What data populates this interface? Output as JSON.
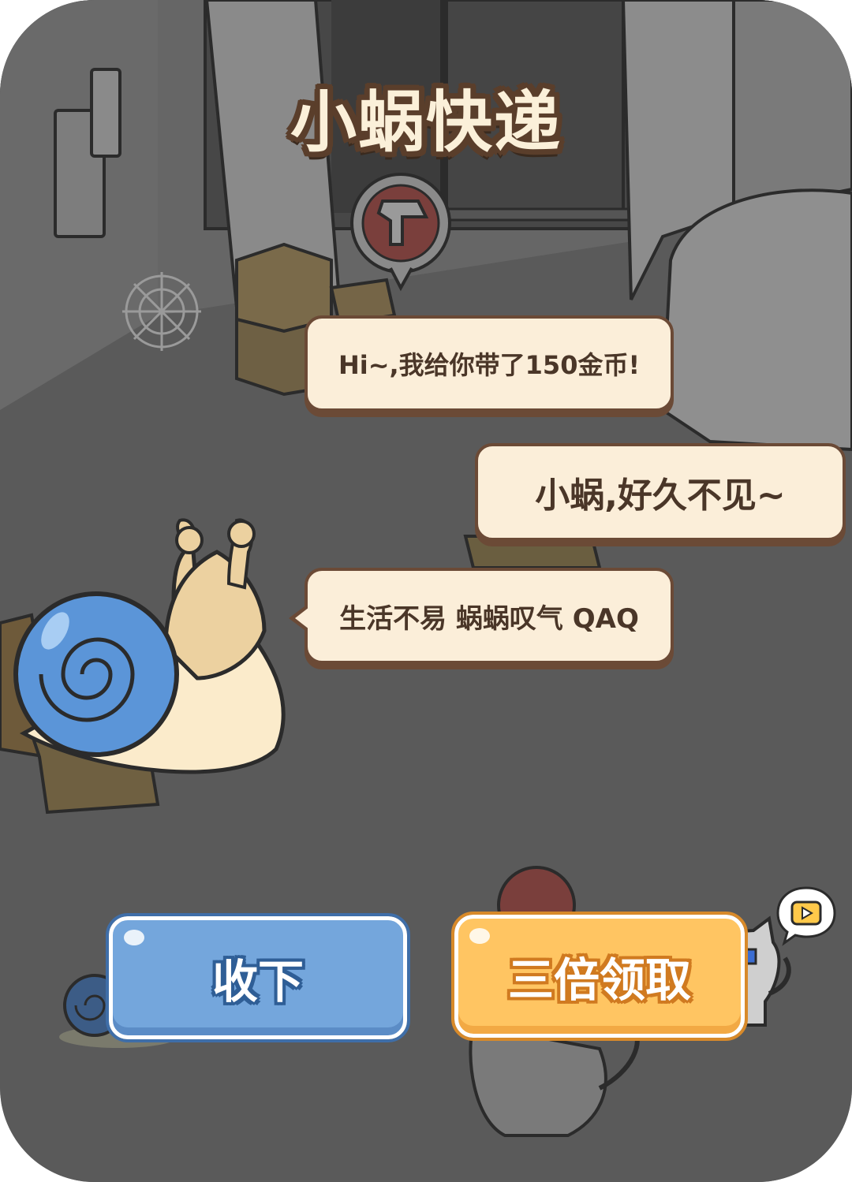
{
  "title": "小蜗快递",
  "dialog": {
    "snail_line_1": "Hi~,我给你带了150金币!",
    "player_reply": "小蜗,好久不见~",
    "snail_line_2": "生活不易 蜗蜗叹气 QAQ"
  },
  "reward": {
    "coins": 150
  },
  "buttons": {
    "collect_label": "收下",
    "triple_label": "三倍领取"
  },
  "icons": {
    "triple_button_video": "play-video-icon",
    "speech_marker": "bone-icon"
  },
  "colors": {
    "title_fill": "#fbf0d9",
    "title_outline": "#5a3e2b",
    "bubble_fill": "#fbeed9",
    "bubble_border": "#6b4a36",
    "collect_button": "#74a6dc",
    "triple_button": "#ffc562",
    "snail_shell": "#5b95d8"
  }
}
